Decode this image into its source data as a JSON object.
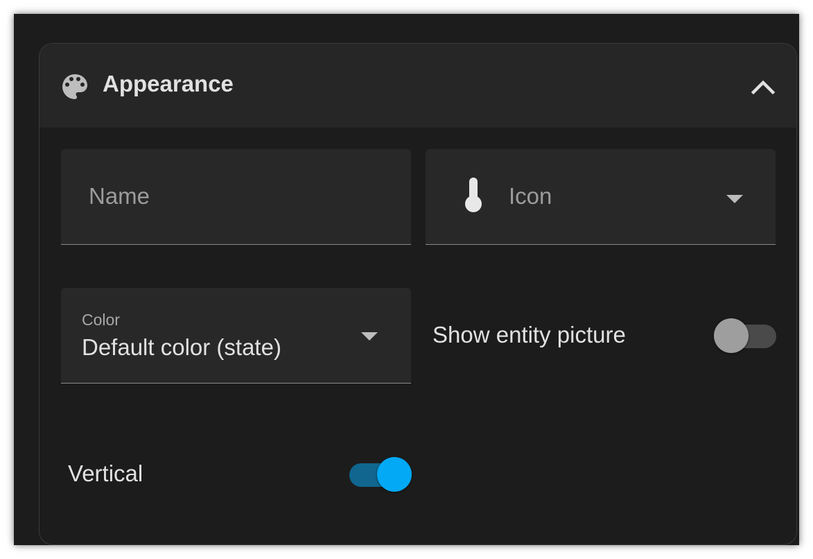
{
  "panel": {
    "title": "Appearance",
    "header_icon": "palette-icon",
    "collapse_icon": "chevron-up-icon",
    "expanded": true
  },
  "fields": {
    "name": {
      "placeholder": "Name",
      "value": ""
    },
    "icon": {
      "placeholder": "Icon",
      "prefix_icon": "thermometer-icon",
      "dropdown_icon": "dropdown-arrow-icon"
    },
    "color": {
      "label": "Color",
      "value": "Default color (state)",
      "dropdown_icon": "dropdown-arrow-icon"
    }
  },
  "toggles": {
    "show_entity_picture": {
      "label": "Show entity picture",
      "checked": false
    },
    "vertical": {
      "label": "Vertical",
      "checked": true
    }
  },
  "colors": {
    "background": "#1c1c1c",
    "header_background": "#262626",
    "field_background": "#282828",
    "text_primary": "#e1e1e1",
    "text_secondary": "#9c9c9c",
    "accent": "#03a9f4",
    "accent_track": "#10668f",
    "switch_off_thumb": "#9e9e9e",
    "switch_off_track": "#4a4a4a"
  }
}
